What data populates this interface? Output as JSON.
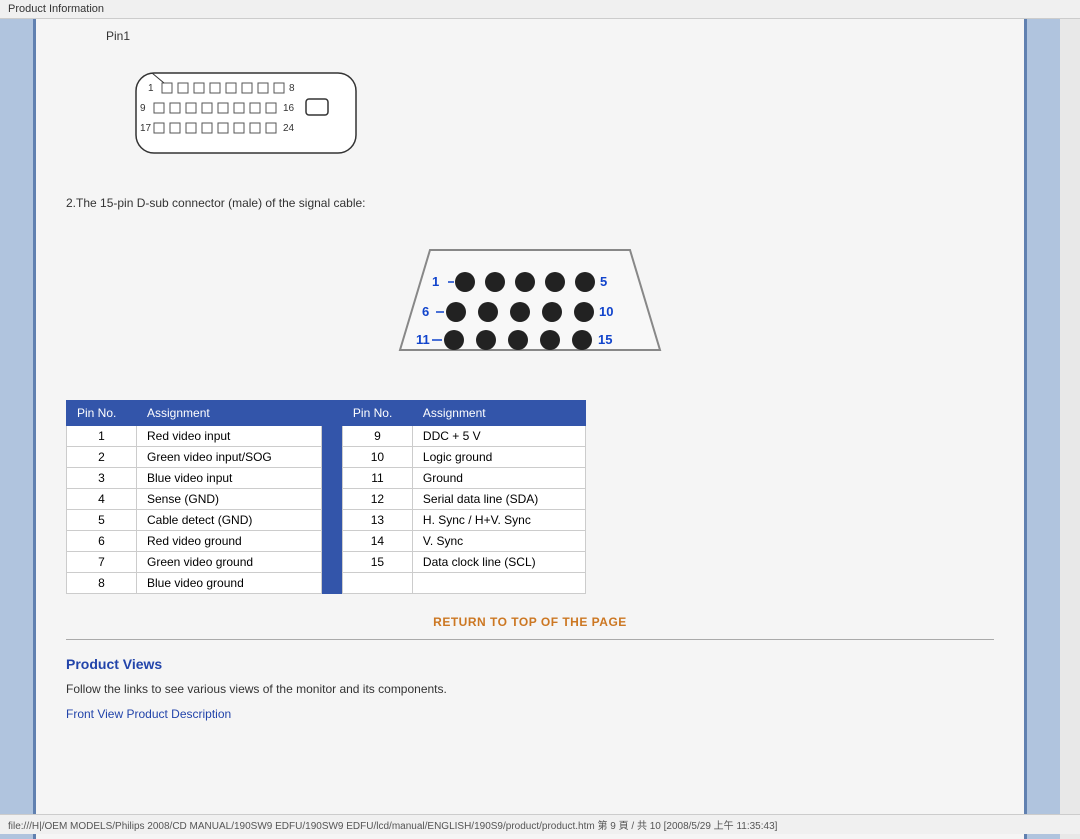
{
  "topbar": {
    "label": "Product Information"
  },
  "connector1": {
    "pin1_label": "Pin1",
    "description": "2.The 15-pin D-sub connector (male) of the signal cable:"
  },
  "table": {
    "col1_header1": "Pin No.",
    "col1_header2": "Assignment",
    "col2_header1": "Pin No.",
    "col2_header2": "Assignment",
    "rows": [
      {
        "pin1": "1",
        "assign1": "Red video input",
        "pin2": "9",
        "assign2": "DDC + 5 V"
      },
      {
        "pin1": "2",
        "assign1": "Green video input/SOG",
        "pin2": "10",
        "assign2": "Logic ground"
      },
      {
        "pin1": "3",
        "assign1": "Blue video input",
        "pin2": "11",
        "assign2": "Ground"
      },
      {
        "pin1": "4",
        "assign1": "Sense (GND)",
        "pin2": "12",
        "assign2": "Serial data line (SDA)"
      },
      {
        "pin1": "5",
        "assign1": "Cable detect (GND)",
        "pin2": "13",
        "assign2": "H. Sync / H+V. Sync"
      },
      {
        "pin1": "6",
        "assign1": "Red video ground",
        "pin2": "14",
        "assign2": "V. Sync"
      },
      {
        "pin1": "7",
        "assign1": "Green video ground",
        "pin2": "15",
        "assign2": "Data clock line (SCL)"
      },
      {
        "pin1": "8",
        "assign1": "Blue video ground",
        "pin2": "",
        "assign2": ""
      }
    ]
  },
  "return_link": {
    "label": "RETURN TO TOP OF THE PAGE",
    "href": "#"
  },
  "product_views": {
    "title": "Product Views",
    "description": "Follow the links to see various views of the monitor and its components.",
    "front_view_link": "Front View Product Description"
  },
  "statusbar": {
    "text": "file:///H|/OEM MODELS/Philips 2008/CD MANUAL/190SW9 EDFU/190SW9 EDFU/lcd/manual/ENGLISH/190S9/product/product.htm 第 9 頁 / 共 10  [2008/5/29 上午 11:35:43]"
  }
}
